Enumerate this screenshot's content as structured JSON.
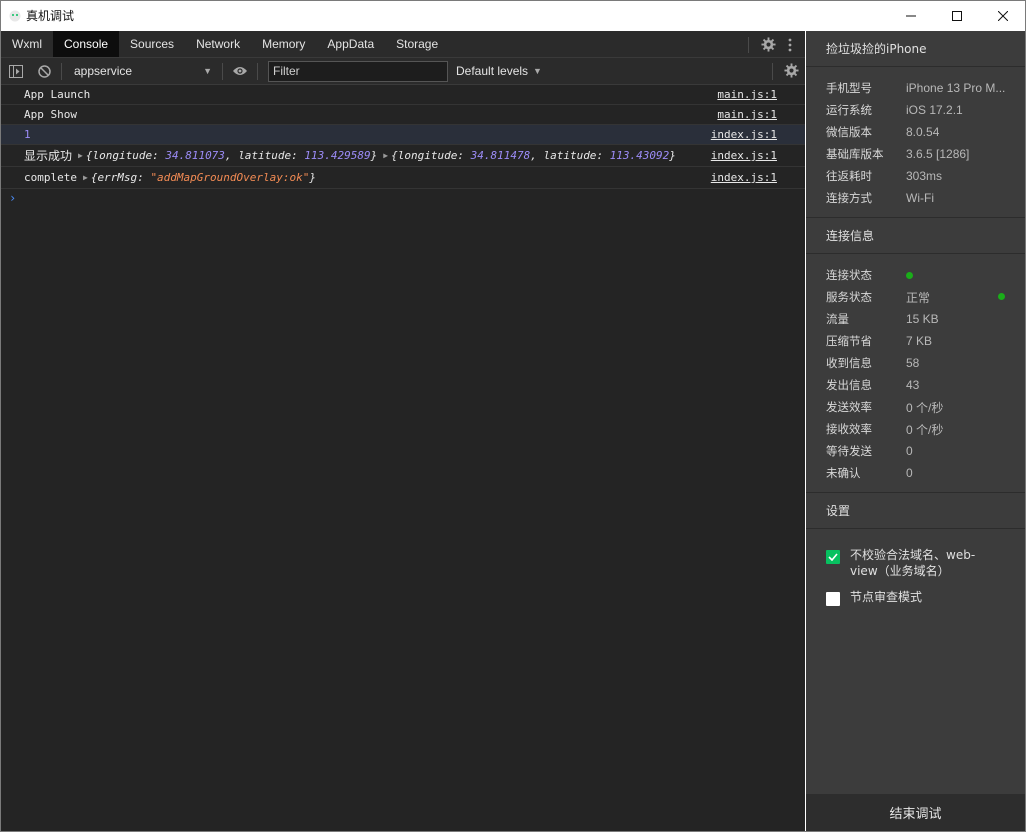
{
  "window": {
    "title": "真机调试",
    "controls": [
      "minimize-icon",
      "maximize-icon",
      "close-icon"
    ]
  },
  "tabs": [
    {
      "label": "Wxml",
      "active": false
    },
    {
      "label": "Console",
      "active": true
    },
    {
      "label": "Sources",
      "active": false
    },
    {
      "label": "Network",
      "active": false
    },
    {
      "label": "Memory",
      "active": false
    },
    {
      "label": "AppData",
      "active": false
    },
    {
      "label": "Storage",
      "active": false
    }
  ],
  "toolbar": {
    "context": "appservice",
    "filter_placeholder": "Filter",
    "levels": "Default levels"
  },
  "console": {
    "rows": [
      {
        "text": "App Launch",
        "source": "main.js:1"
      },
      {
        "text": "App Show",
        "source": "main.js:1"
      },
      {
        "text": "1",
        "source": "index.js:1"
      },
      {
        "label": "显示成功",
        "obj1": {
          "k1": "longitude",
          "v1": "34.811073",
          "k2": "latitude",
          "v2": "113.429589"
        },
        "obj2": {
          "k1": "longitude",
          "v1": "34.811478",
          "k2": "latitude",
          "v2": "113.43092"
        },
        "source": "index.js:1"
      },
      {
        "label": "complete",
        "key": "errMsg",
        "value": "\"addMapGroundOverlay:ok\"",
        "source": "index.js:1"
      }
    ],
    "prompt": "›"
  },
  "panel": {
    "device_title": "捡垃圾捡的iPhone",
    "device_info": [
      {
        "key": "手机型号",
        "value": "iPhone 13 Pro M..."
      },
      {
        "key": "运行系统",
        "value": "iOS 17.2.1"
      },
      {
        "key": "微信版本",
        "value": "8.0.54"
      },
      {
        "key": "基础库版本",
        "value": "3.6.5 [1286]"
      },
      {
        "key": "往返耗时",
        "value": "303ms"
      },
      {
        "key": "连接方式",
        "value": "Wi-Fi"
      }
    ],
    "conn_title": "连接信息",
    "conn_info": [
      {
        "key": "连接状态",
        "value": ""
      },
      {
        "key": "服务状态",
        "value": "正常"
      },
      {
        "key": "流量",
        "value": "15 KB"
      },
      {
        "key": "压缩节省",
        "value": "7 KB"
      },
      {
        "key": "收到信息",
        "value": "58"
      },
      {
        "key": "发出信息",
        "value": "43"
      },
      {
        "key": "发送效率",
        "value": "0 个/秒"
      },
      {
        "key": "接收效率",
        "value": "0 个/秒"
      },
      {
        "key": "等待发送",
        "value": "0"
      },
      {
        "key": "未确认",
        "value": "0"
      }
    ],
    "status_color": "#1aad19",
    "settings_title": "设置",
    "settings": [
      {
        "label": "不校验合法域名、web-view（业务域名）",
        "checked": true
      },
      {
        "label": "节点审查模式",
        "checked": false
      }
    ],
    "end_button": "结束调试"
  },
  "colors": {
    "accent": "#07c160",
    "number": "#9c8cf7",
    "string": "#f28b54",
    "prompt": "#4b8df8"
  }
}
